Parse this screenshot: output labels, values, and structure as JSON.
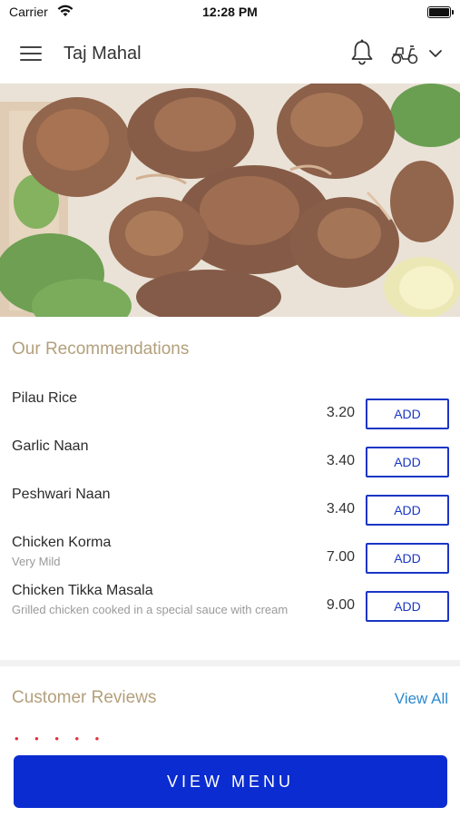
{
  "status_bar": {
    "carrier": "Carrier",
    "time": "12:28 PM"
  },
  "header": {
    "title": "Taj Mahal",
    "icons": [
      "menu-icon",
      "bell-icon",
      "scooter-icon",
      "chevron-down-icon"
    ]
  },
  "recommendations": {
    "title": "Our Recommendations",
    "items": [
      {
        "name": "Pilau Rice",
        "description": "",
        "price": "3.20",
        "button": "ADD"
      },
      {
        "name": "Garlic Naan",
        "description": "",
        "price": "3.40",
        "button": "ADD"
      },
      {
        "name": "Peshwari Naan",
        "description": "",
        "price": "3.40",
        "button": "ADD"
      },
      {
        "name": "Chicken Korma",
        "description": "Very Mild",
        "price": "7.00",
        "button": "ADD"
      },
      {
        "name": "Chicken Tikka Masala",
        "description": "Grilled chicken cooked in a special sauce with cream",
        "price": "9.00",
        "button": "ADD"
      }
    ]
  },
  "reviews": {
    "title": "Customer Reviews",
    "view_all": "View All",
    "stars": "• • • • •"
  },
  "footer": {
    "view_menu": "VIEW MENU"
  },
  "colors": {
    "accent_blue": "#0b2cd1",
    "section_title": "#b3a07c",
    "link": "#2b8ad0",
    "stars": "#e0303a"
  }
}
